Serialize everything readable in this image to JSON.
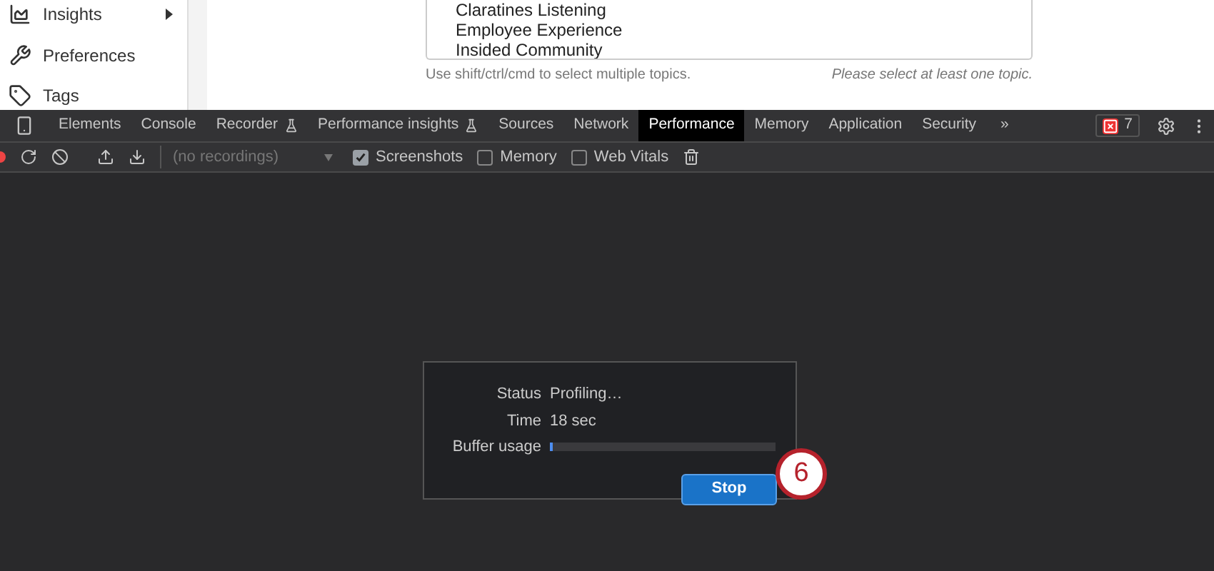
{
  "sidebar": {
    "items": [
      {
        "label": "Insights",
        "kind": "insights",
        "has_submenu": true
      },
      {
        "label": "Preferences",
        "kind": "preferences",
        "has_submenu": false
      },
      {
        "label": "Tags",
        "kind": "tags",
        "has_submenu": false
      }
    ]
  },
  "topics_list": {
    "items": [
      "Claratines Listening",
      "Employee Experience",
      "Insided Community"
    ],
    "hint": "Use shift/ctrl/cmd to select multiple topics.",
    "validation": "Please select at least one topic."
  },
  "devtools": {
    "tabs": [
      {
        "label": "Elements",
        "selected": false,
        "experimental": false
      },
      {
        "label": "Console",
        "selected": false,
        "experimental": false
      },
      {
        "label": "Recorder",
        "selected": false,
        "experimental": true
      },
      {
        "label": "Performance insights",
        "selected": false,
        "experimental": true
      },
      {
        "label": "Sources",
        "selected": false,
        "experimental": false
      },
      {
        "label": "Network",
        "selected": false,
        "experimental": false
      },
      {
        "label": "Performance",
        "selected": true,
        "experimental": false
      },
      {
        "label": "Memory",
        "selected": false,
        "experimental": false
      },
      {
        "label": "Application",
        "selected": false,
        "experimental": false
      },
      {
        "label": "Security",
        "selected": false,
        "experimental": false
      }
    ],
    "overflow": "»",
    "error_count": "7",
    "recordings_placeholder": "(no recordings)",
    "checkboxes": [
      {
        "label": "Screenshots",
        "checked": true
      },
      {
        "label": "Memory",
        "checked": false
      },
      {
        "label": "Web Vitals",
        "checked": false
      }
    ]
  },
  "profiling_dialog": {
    "rows": [
      {
        "label": "Status",
        "value": "Profiling…"
      },
      {
        "label": "Time",
        "value": "18 sec"
      }
    ],
    "buffer_label": "Buffer usage",
    "buffer": {
      "level": 0.01
    },
    "stop_button": "Stop"
  },
  "step_badge": "6"
}
